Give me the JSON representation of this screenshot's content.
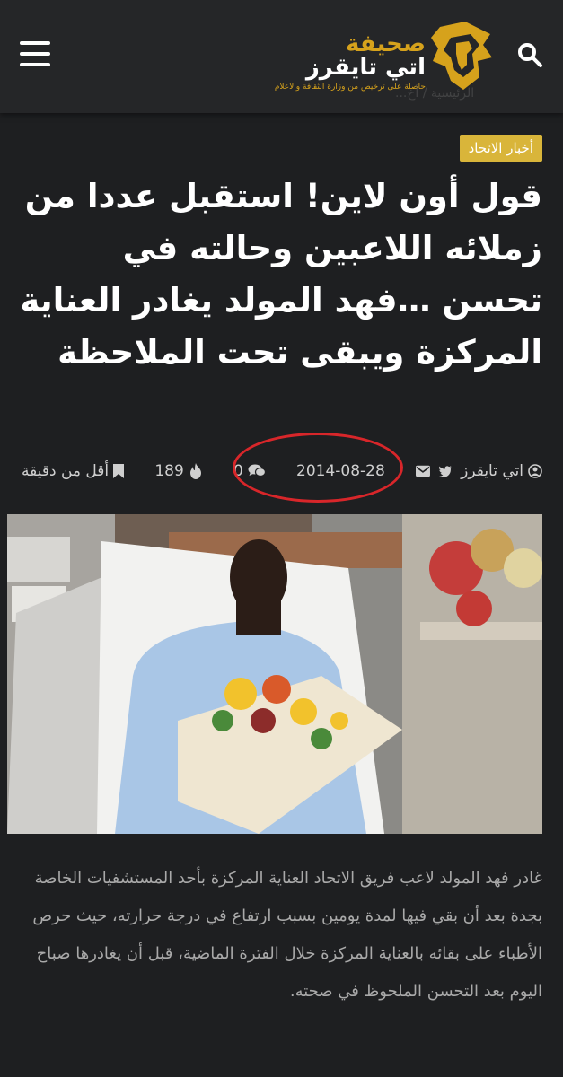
{
  "header": {
    "logo_title_line1": "صحيفة",
    "logo_title_line2": "اتي تايقرز",
    "logo_subtitle": "حاصلة على ترخيص من وزارة الثقافة والاعلام",
    "breadcrumb": "الرئيسية / أخ..."
  },
  "article": {
    "category": "أخبار الاتحاد",
    "title": "قول أون لاين! استقبل عددا من زملائه اللاعبين وحالته في تحسن …فهد المولد يغادر العناية المركزة ويبقى تحت الملاحظة",
    "meta": {
      "author": "اتي تايقرز",
      "date": "2014-08-28",
      "comments": "0",
      "views": "189",
      "read_time": "أقل من دقيقة"
    },
    "body": "غادر فهد المولد لاعب فريق الاتحاد العناية المركزة بأحد المستشفيات الخاصة بجدة بعد أن بقي فيها لمدة يومين بسبب ارتفاع في درجة حرارته، حيث حرص الأطباء على بقائه بالعناية المركزة خلال الفترة الماضية، قبل أن يغادرها صباح اليوم بعد التحسن الملحوظ في صحته."
  },
  "colors": {
    "background": "#1e1f21",
    "header": "#252628",
    "accent": "#d9b53a",
    "annotation": "#d8262a"
  },
  "icons": [
    "menu-icon",
    "search-icon",
    "user-icon",
    "twitter-icon",
    "mail-icon",
    "comment-icon",
    "fire-icon",
    "bookmark-icon"
  ]
}
